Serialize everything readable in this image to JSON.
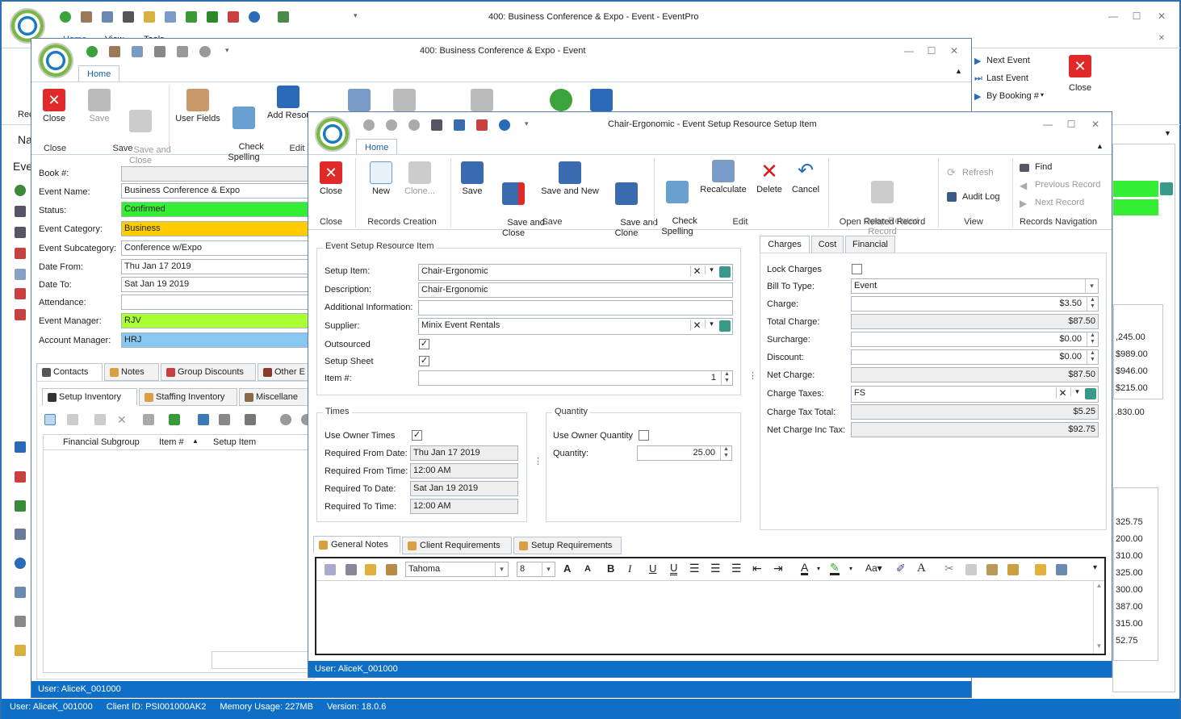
{
  "main": {
    "title": "400: Business Conference & Expo - Event - EventPro",
    "tabs": [
      "Home",
      "View",
      "Tools"
    ],
    "left_label_rec": "Rec",
    "left_label_na": "Na",
    "left_label_eve": "Eve",
    "nav": {
      "next": "Next Event",
      "last": "Last Event",
      "by_booking": "By Booking #",
      "close": "Close"
    },
    "status": {
      "user": "User: AliceK_001000",
      "client": "Client ID: PSI001000AK2",
      "memory": "Memory Usage: 227MB",
      "version": "Version: 18.0.6"
    },
    "right_values": [
      ",245.00",
      "$989.00",
      "$946.00",
      "$215.00",
      ".830.00",
      "325.75",
      "200.00",
      "310.00",
      "325.00",
      "300.00",
      "387.00",
      "315.00",
      "52.75"
    ]
  },
  "event": {
    "title": "400: Business Conference & Expo - Event",
    "tab": "Home",
    "ribbon": {
      "close": "Close",
      "save": "Save",
      "save_and_close": "Save and\nClose",
      "user_fields": "User Fields",
      "check_spelling": "Check\nSpelling",
      "add_resource": "Add Resou",
      "grp_close": "Close",
      "grp_save": "Save",
      "grp_edit": "Edit"
    },
    "fields": {
      "book_lbl": "Book #:",
      "book": "",
      "name_lbl": "Event Name:",
      "name": "Business Conference & Expo",
      "status_lbl": "Status:",
      "status": "Confirmed",
      "cat_lbl": "Event Category:",
      "cat": "Business",
      "subcat_lbl": "Event Subcategory:",
      "subcat": "Conference w/Expo",
      "from_lbl": "Date From:",
      "from": "Thu Jan 17 2019",
      "to_lbl": "Date To:",
      "to": "Sat Jan 19 2019",
      "att_lbl": "Attendance:",
      "att": "",
      "em_lbl": "Event Manager:",
      "em": "RJV",
      "am_lbl": "Account Manager:",
      "am": "HRJ"
    },
    "colors": {
      "status": "#33ee33",
      "cat": "#ffcc00",
      "em": "#aaff33",
      "am": "#88c8f0"
    },
    "tabs1": [
      "Contacts",
      "Notes",
      "Group Discounts",
      "Other E"
    ],
    "tabs2": [
      "Setup Inventory",
      "Staffing Inventory",
      "Miscellane"
    ],
    "grid_cols": [
      "Financial Subgroup",
      "Item #",
      "Setup Item"
    ],
    "status": "User: AliceK_001000"
  },
  "setup": {
    "title": "Chair-Ergonomic - Event Setup Resource Setup Item",
    "tab": "Home",
    "ribbon": {
      "close": "Close",
      "new": "New",
      "clone": "Clone...",
      "save": "Save",
      "save_close": "Save and\nClose",
      "save_new": "Save and New",
      "save_clone": "Save and\nClone",
      "check": "Check\nSpelling",
      "recalc": "Recalculate",
      "delete": "Delete",
      "cancel": "Cancel",
      "open_related": "Open Related\nRecord",
      "refresh": "Refresh",
      "audit": "Audit Log",
      "find": "Find",
      "prev": "Previous Record",
      "next": "Next Record",
      "groups": [
        "Close",
        "Records Creation",
        "Save",
        "Edit",
        "Open Related Record",
        "View",
        "Records Navigation"
      ]
    },
    "item_group": "Event Setup Resource Item",
    "item": {
      "setup_lbl": "Setup Item:",
      "setup": "Chair-Ergonomic",
      "desc_lbl": "Description:",
      "desc": "Chair-Ergonomic",
      "addl_lbl": "Additional Information:",
      "addl": "",
      "supp_lbl": "Supplier:",
      "supp": "Minix Event Rentals",
      "out_lbl": "Outsourced",
      "sheet_lbl": "Setup Sheet",
      "itemno_lbl": "Item #:",
      "itemno": "1"
    },
    "times_group": "Times",
    "times": {
      "owner_lbl": "Use Owner Times",
      "rfd_lbl": "Required From Date:",
      "rfd": "Thu Jan 17 2019",
      "rft_lbl": "Required From Time:",
      "rft": "12:00 AM",
      "rtd_lbl": "Required To Date:",
      "rtd": "Sat Jan 19 2019",
      "rtt_lbl": "Required To Time:",
      "rtt": "12:00 AM"
    },
    "qty_group": "Quantity",
    "qty": {
      "owner_lbl": "Use Owner Quantity",
      "qty_lbl": "Quantity:",
      "qty": "25.00"
    },
    "charge_tabs": [
      "Charges",
      "Cost",
      "Financial"
    ],
    "charges": {
      "lock_lbl": "Lock Charges",
      "bill_lbl": "Bill To Type:",
      "bill": "Event",
      "charge_lbl": "Charge:",
      "charge": "$3.50",
      "total_lbl": "Total Charge:",
      "total": "$87.50",
      "sur_lbl": "Surcharge:",
      "sur": "$0.00",
      "disc_lbl": "Discount:",
      "disc": "$0.00",
      "net_lbl": "Net Charge:",
      "net": "$87.50",
      "tax_lbl": "Charge Taxes:",
      "tax": "FS",
      "taxtot_lbl": "Charge Tax Total:",
      "taxtot": "$5.25",
      "netinc_lbl": "Net Charge Inc Tax:",
      "netinc": "$92.75"
    },
    "note_tabs": [
      "General Notes",
      "Client Requirements",
      "Setup Requirements"
    ],
    "font": "Tahoma",
    "font_size": "8",
    "status": "User: AliceK_001000"
  }
}
